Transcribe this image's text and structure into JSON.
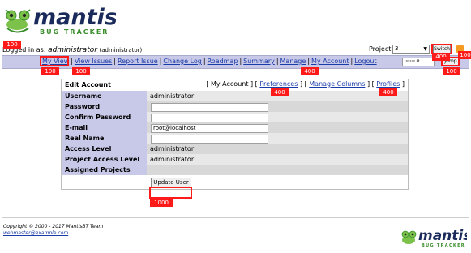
{
  "brand": {
    "name": "mantis",
    "sub": "BUG TRACKER"
  },
  "session": {
    "prefix": "Logged in as:",
    "user": "administrator",
    "role": "(administrator)"
  },
  "project": {
    "label": "Project:",
    "selected": "3",
    "switch_label": "Switch"
  },
  "nav": {
    "items": [
      "My View",
      "View Issues",
      "Report Issue",
      "Change Log",
      "Roadmap",
      "Summary",
      "Manage",
      "My Account",
      "Logout"
    ],
    "issue_placeholder": "Issue #",
    "jump_label": "Jump"
  },
  "account": {
    "title": "Edit Account",
    "links": {
      "my_account": "My Account",
      "preferences": "Preferences",
      "manage_columns": "Manage Columns",
      "profiles": "Profiles"
    },
    "rows": [
      {
        "label": "Username",
        "value": "administrator"
      },
      {
        "label": "Password",
        "value": ""
      },
      {
        "label": "Confirm Password",
        "value": ""
      },
      {
        "label": "E-mail",
        "value": "root@localhost"
      },
      {
        "label": "Real Name",
        "value": ""
      },
      {
        "label": "Access Level",
        "value": "administrator"
      },
      {
        "label": "Project Access Level",
        "value": "administrator"
      },
      {
        "label": "Assigned Projects",
        "value": ""
      }
    ],
    "update_label": "Update User"
  },
  "footer": {
    "copyright": "Copyright © 2000 - 2017 MantisBT Team",
    "email": "webmaster@example.com"
  },
  "annotations": {
    "logo": "100",
    "my_view": "100",
    "view_issues": "100",
    "preferences": "400",
    "my_account": "400",
    "profiles": "400",
    "switch": "400",
    "rss": "100",
    "jump": "100",
    "update": "1000"
  },
  "colors": {
    "navbar": "#c8c8e8",
    "label_bg": "#c8c8e8",
    "annotation": "#ff1a1a",
    "link": "#1a3ca8",
    "brand_green": "#3a8f2c"
  }
}
